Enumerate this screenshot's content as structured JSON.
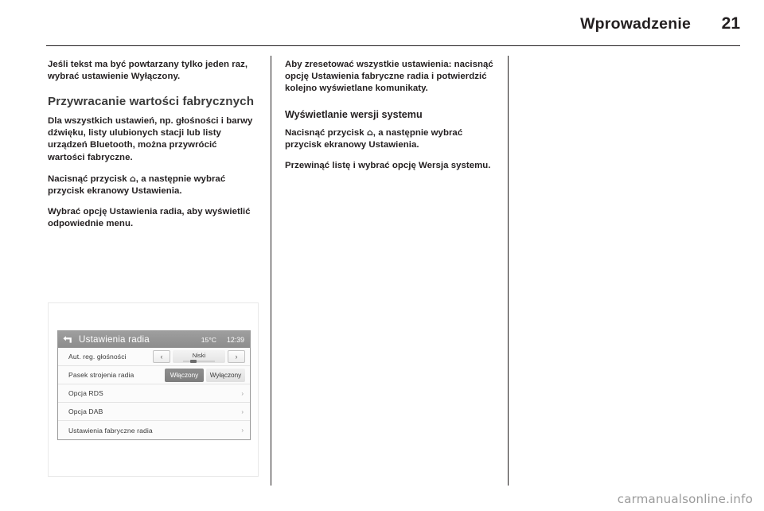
{
  "header": {
    "title": "Wprowadzenie",
    "page_number": "21"
  },
  "columns": {
    "left": {
      "para_1": "Jeśli tekst ma być powtarzany tylko jeden raz, wybrać ustawienie Wyłączony.",
      "heading_1": "Przywracanie wartości fabrycznych",
      "para_2": "Dla wszystkich ustawień, np. głośności i barwy dźwięku, listy ulubionych stacji lub listy urządzeń Bluetooth, można przywrócić wartości fabryczne.",
      "para_3_before": "Nacisnąć przycisk ",
      "para_3_glyph": "⌂",
      "para_3_after": ", a następnie wybrać przycisk ekranowy Ustawienia.",
      "para_4": "Wybrać opcję Ustawienia radia, aby wyświetlić odpowiednie menu."
    },
    "middle": {
      "para_1": "Aby zresetować wszystkie ustawienia: nacisnąć opcję Ustawienia fabryczne radia i potwierdzić kolejno wyświetlane komunikaty.",
      "heading_1": "Wyświetlanie wersji systemu",
      "para_2_before": "Nacisnąć przycisk ",
      "para_2_glyph": "⌂",
      "para_2_after": ", a następnie wybrać przycisk ekranowy Ustawienia.",
      "para_3": "Przewinąć listę i wybrać opcję Wersja systemu."
    }
  },
  "figure": {
    "screen": {
      "back_icon": "back-arrow-icon",
      "title": "Ustawienia radia",
      "temperature": "15°C",
      "clock": "12:39",
      "rows": [
        {
          "label": "Aut. reg. głośności",
          "control": "stepper",
          "prev": "‹",
          "value": "Niski",
          "next": "›"
        },
        {
          "label": "Pasek strojenia radia",
          "control": "toggle",
          "on_label": "Włączony",
          "off_label": "Wyłączony",
          "selected": "Włączony"
        },
        {
          "label": "Opcja RDS",
          "control": "submenu",
          "chevron": "›"
        },
        {
          "label": "Opcja DAB",
          "control": "submenu",
          "chevron": "›"
        },
        {
          "label": "Ustawienia fabryczne radia",
          "control": "submenu",
          "chevron": "›"
        }
      ]
    }
  },
  "watermark": {
    "text": "carmanualsonline.info"
  },
  "colors": {
    "ink": "#231f20",
    "titlebar": "#909090",
    "toggle_active": "#868686"
  }
}
